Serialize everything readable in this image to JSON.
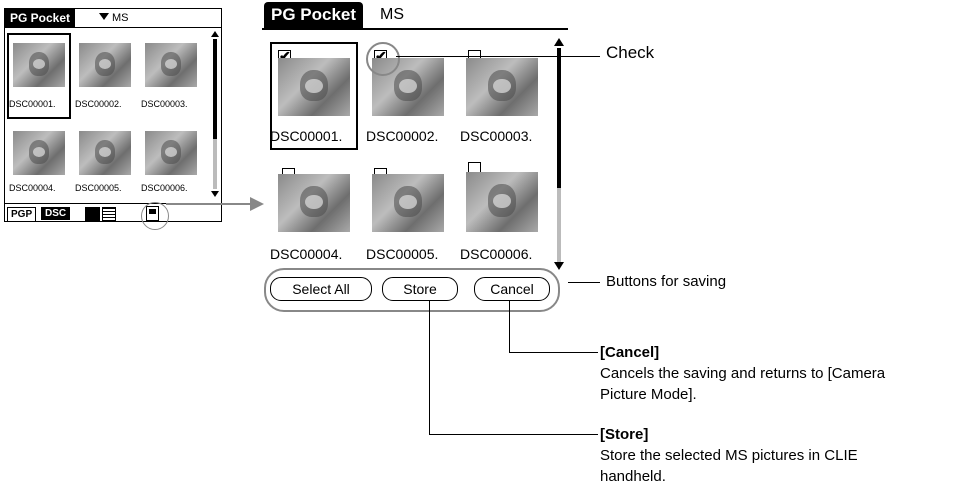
{
  "small_screen": {
    "title": "PG Pocket",
    "media": "MS",
    "thumbnails": [
      "DSC00001.",
      "DSC00002.",
      "DSC00003.",
      "DSC00004.",
      "DSC00005.",
      "DSC00006."
    ],
    "tabs": [
      "PGP",
      "DSC"
    ]
  },
  "big_screen": {
    "title": "PG Pocket",
    "media": "MS",
    "thumbnails": [
      {
        "label": "DSC00001.",
        "checked": true
      },
      {
        "label": "DSC00002.",
        "checked": true
      },
      {
        "label": "DSC00003.",
        "checked": false
      },
      {
        "label": "DSC00004.",
        "checked": false
      },
      {
        "label": "DSC00005.",
        "checked": false
      },
      {
        "label": "DSC00006.",
        "checked": false
      }
    ],
    "buttons": {
      "select_all": "Select All",
      "store": "Store",
      "cancel": "Cancel"
    }
  },
  "callouts": {
    "check": "Check",
    "buttons_for_saving": "Buttons for saving",
    "cancel_title": "[Cancel]",
    "cancel_desc_1": "Cancels the saving and returns to [Camera",
    "cancel_desc_2": "Picture Mode].",
    "store_title": "[Store]",
    "store_desc_1": "Store the selected MS pictures in CLIE",
    "store_desc_2": "handheld."
  }
}
